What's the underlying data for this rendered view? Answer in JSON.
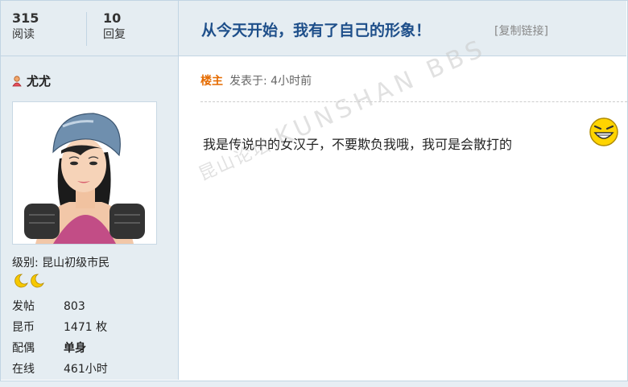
{
  "stats": {
    "reads_count": "315",
    "reads_label": "阅读",
    "replies_count": "10",
    "replies_label": "回复"
  },
  "thread": {
    "title": "从今天开始，我有了自己的形象！",
    "copy_link": "[复制链接]"
  },
  "user": {
    "name": "尤尤",
    "level": "级别: 昆山初级市民",
    "fields": [
      {
        "key": "发帖",
        "value": "803"
      },
      {
        "key": "昆币",
        "value": "1471 枚"
      },
      {
        "key": "配偶",
        "value": "单身"
      },
      {
        "key": "在线",
        "value": "461小时"
      }
    ]
  },
  "post": {
    "author_tag": "楼主",
    "posted_at": "发表于: 4小时前",
    "content": "我是传说中的女汉子，不要欺负我哦，我可是会散打的"
  },
  "watermark": {
    "cn": "昆山论坛",
    "en": "KUNSHAN BBS"
  },
  "colors": {
    "header_bg": "#e5edf2",
    "border": "#c2d5e3",
    "title": "#1e4f8a",
    "author_tag": "#e56b00"
  }
}
